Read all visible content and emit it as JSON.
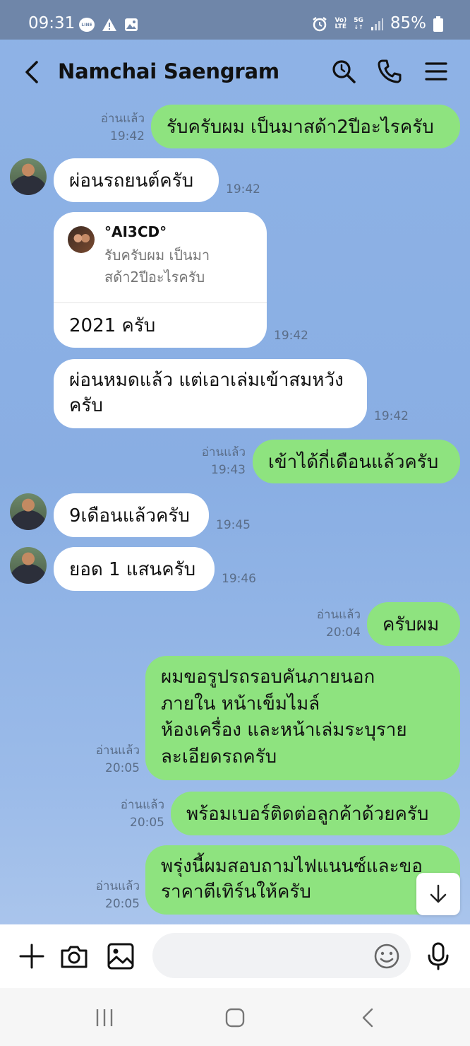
{
  "status_bar": {
    "time": "09:31",
    "line_badge": "LINE",
    "volte_top": "Vo)",
    "volte_bottom": "LTE",
    "network": "5G",
    "battery": "85%"
  },
  "header": {
    "title": "Namchai Saengram",
    "icons": [
      "back-arrow-icon",
      "search-icon",
      "phone-icon",
      "menu-icon"
    ]
  },
  "messages": [
    {
      "from": "me",
      "text": "รับครับผม เป็นมาสด้า2ปีอะไรครับ",
      "read": "อ่านแล้ว",
      "time": "19:42"
    },
    {
      "from": "them",
      "text": "ผ่อนรถยนต์ครับ",
      "time": "19:42"
    },
    {
      "from": "them",
      "reply_to_name": "°AI3CD°",
      "reply_to_text": "รับครับผม เป็นมาสด้า2ปีอะไรครับ",
      "text": "2021 ครับ",
      "time": "19:42"
    },
    {
      "from": "them",
      "lines": [
        "ผ่อนหมดแล้ว แต่เอาเล่มเข้าสมหวัง",
        "ครับ"
      ],
      "time": "19:42"
    },
    {
      "from": "me",
      "text": "เข้าได้กี่เดือนแล้วครับ",
      "read": "อ่านแล้ว",
      "time": "19:43"
    },
    {
      "from": "them",
      "text": "9เดือนแล้วครับ",
      "time": "19:45"
    },
    {
      "from": "them",
      "text": "ยอด 1 แสนครับ",
      "time": "19:46"
    },
    {
      "from": "me",
      "text": "ครับผม",
      "read": "อ่านแล้ว",
      "time": "20:04"
    },
    {
      "from": "me",
      "lines": [
        "ผมขอรูปรถรอบคันภายนอก",
        "ภายใน หน้าเข็มไมล์",
        "ห้องเครื่อง และหน้าเล่มระบุราย",
        "ละเอียดรถครับ"
      ],
      "read": "อ่านแล้ว",
      "time": "20:05"
    },
    {
      "from": "me",
      "text": "พร้อมเบอร์ติดต่อลูกค้าด้วยครับ",
      "read": "อ่านแล้ว",
      "time": "20:05"
    },
    {
      "from": "me",
      "lines": [
        "พรุ่งนี้ผมสอบถามไฟแนนซ์และขอ",
        "ราคาตีเทิร์นให้ครับ"
      ],
      "read": "อ่านแล้ว",
      "time": "20:05"
    }
  ],
  "input_bar": {
    "placeholder": "",
    "icons": [
      "plus-icon",
      "camera-icon",
      "image-icon",
      "emoji-icon",
      "microphone-icon"
    ]
  },
  "nav_bar": {
    "icons": [
      "recents-icon",
      "home-icon",
      "back-icon"
    ]
  },
  "colors": {
    "status_bar": "#6f86a9",
    "chat_background": "#8fb3e6",
    "my_bubble": "#8ee37f",
    "their_bubble": "#ffffff"
  }
}
